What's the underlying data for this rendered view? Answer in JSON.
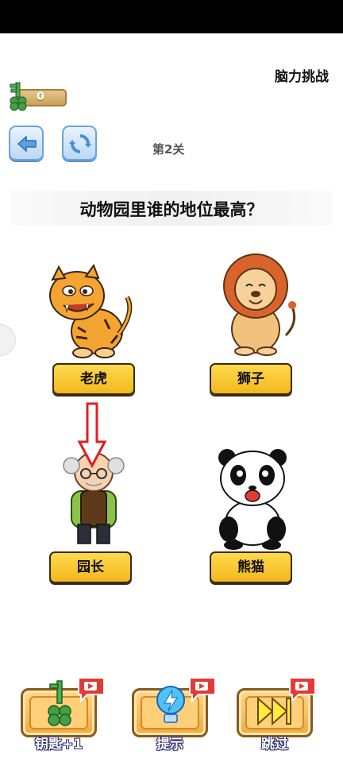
{
  "header": {
    "game_title": "脑力挑战",
    "key_count": "0",
    "level": "第2关"
  },
  "question": "动物园里谁的地位最高？",
  "answers": [
    {
      "label": "老虎",
      "icon": "tiger-icon"
    },
    {
      "label": "狮子",
      "icon": "lion-icon"
    },
    {
      "label": "园长",
      "icon": "zookeeper-icon"
    },
    {
      "label": "熊猫",
      "icon": "panda-icon"
    }
  ],
  "bottom_bar": {
    "keys_label": "钥匙+1",
    "hint_label": "提示",
    "skip_label": "跳过"
  },
  "colors": {
    "answer_button": "#f2b81e",
    "nav_button": "#bcd8f5",
    "hint_arrow": "#e02020",
    "bottom_button": "#f2a93a"
  }
}
